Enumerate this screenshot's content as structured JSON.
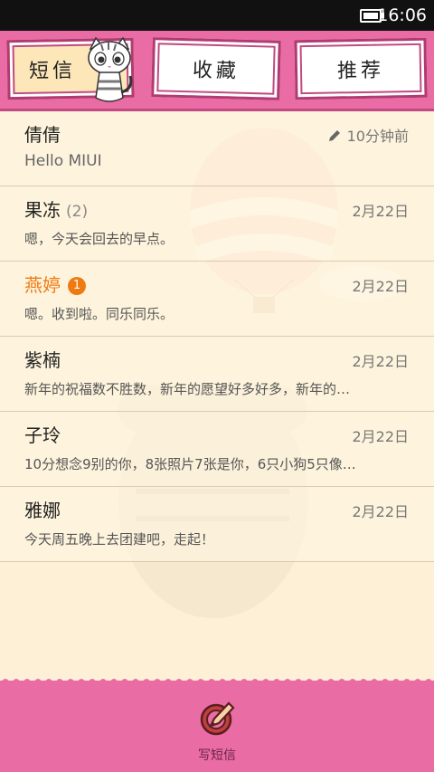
{
  "status_bar": {
    "time": "16:06"
  },
  "tabs": [
    {
      "label": "短信",
      "active": true
    },
    {
      "label": "收藏",
      "active": false
    },
    {
      "label": "推荐",
      "active": false
    }
  ],
  "threads": [
    {
      "name": "倩倩",
      "count": "",
      "badge": "",
      "snippet": "Hello MIUI",
      "time": "10分钟前",
      "draft": true
    },
    {
      "name": "果冻",
      "count": "(2)",
      "badge": "",
      "snippet": "嗯，今天会回去的早点。",
      "time": "2月22日"
    },
    {
      "name": "燕婷",
      "count": "",
      "badge": "1",
      "snippet": "嗯。收到啦。同乐同乐。",
      "time": "2月22日"
    },
    {
      "name": "紫楠",
      "count": "",
      "badge": "",
      "snippet": "新年的祝福数不胜数，新年的愿望好多好多，新年的…",
      "time": "2月22日"
    },
    {
      "name": "子玲",
      "count": "",
      "badge": "",
      "snippet": "10分想念9别的你，8张照片7张是你，6只小狗5只像…",
      "time": "2月22日"
    },
    {
      "name": "雅娜",
      "count": "",
      "badge": "",
      "snippet": "今天周五晚上去团建吧，走起！",
      "time": "2月22日"
    }
  ],
  "footer": {
    "compose_label": "写短信"
  },
  "colors": {
    "accent": "#e96ca4",
    "unread": "#f07a12",
    "background": "#fdf0d6"
  }
}
